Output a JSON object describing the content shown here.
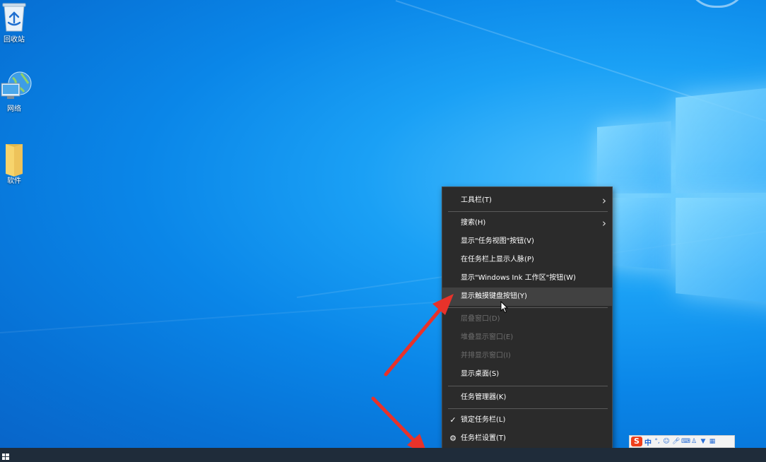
{
  "desktop": {
    "icons": [
      {
        "label": "回收站",
        "icon": "recycle-bin-icon"
      },
      {
        "label": "网络",
        "icon": "network-icon"
      },
      {
        "label": "软件",
        "icon": "folder-icon"
      }
    ]
  },
  "context_menu": {
    "items": [
      {
        "label": "工具栏(T)",
        "submenu": true,
        "enabled": true
      },
      {
        "label": "搜索(H)",
        "submenu": true,
        "enabled": true
      },
      {
        "label": "显示\"任务视图\"按钮(V)",
        "enabled": true
      },
      {
        "label": "在任务栏上显示人脉(P)",
        "enabled": true
      },
      {
        "label": "显示\"Windows Ink 工作区\"按钮(W)",
        "enabled": true
      },
      {
        "label": "显示触摸键盘按钮(Y)",
        "enabled": true,
        "highlighted": true
      },
      {
        "label": "层叠窗口(D)",
        "enabled": false
      },
      {
        "label": "堆叠显示窗口(E)",
        "enabled": false
      },
      {
        "label": "并排显示窗口(I)",
        "enabled": false
      },
      {
        "label": "显示桌面(S)",
        "enabled": true
      },
      {
        "label": "任务管理器(K)",
        "enabled": true
      },
      {
        "label": "锁定任务栏(L)",
        "enabled": true,
        "checked": true,
        "lead_icon": "checkmark-icon"
      },
      {
        "label": "任务栏设置(T)",
        "enabled": true,
        "lead_icon": "gear-icon"
      }
    ],
    "chevron": "›",
    "checkmark": "✓",
    "gear": "⚙"
  },
  "ime_toolbar": {
    "logo": "S",
    "language": "中",
    "icons": [
      "punctuation-icon",
      "emoji-icon",
      "microphone-icon",
      "keyboard-icon",
      "user-icon",
      "skin-icon",
      "toolbox-icon"
    ]
  },
  "colors": {
    "menu_bg": "#2b2b2b",
    "menu_highlight": "#414141",
    "taskbar": "#1f2c3a",
    "arrow": "#e8322a",
    "ime_logo": "#ef3f1c"
  }
}
